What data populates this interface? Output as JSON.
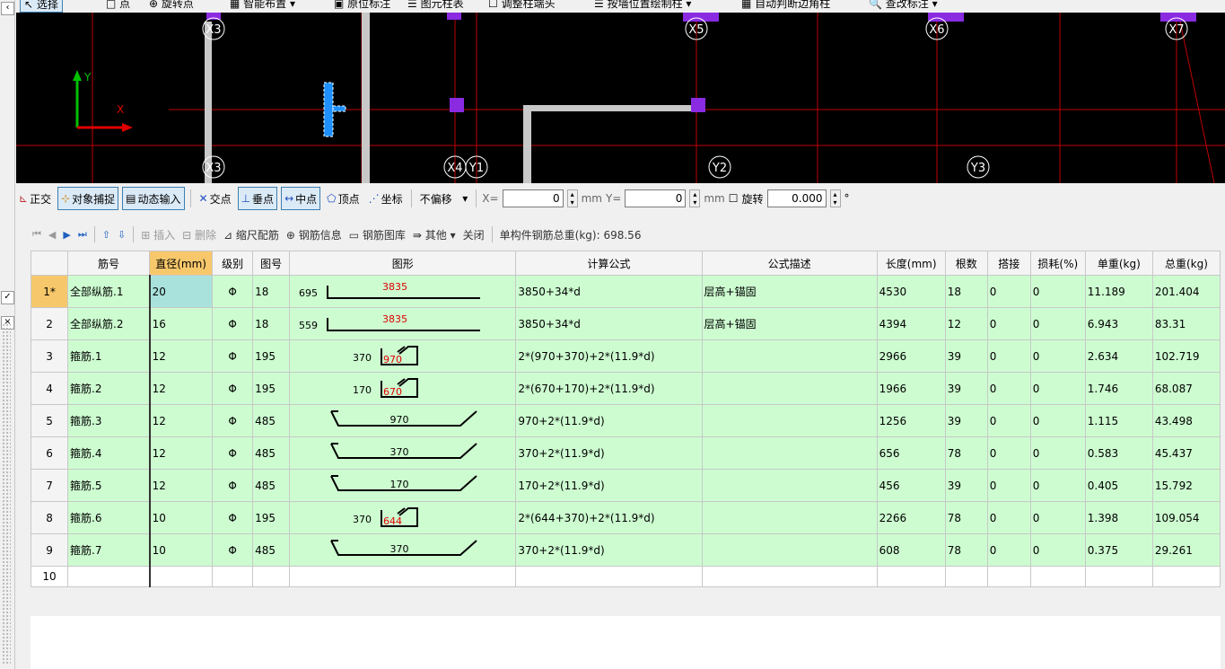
{
  "top_toolbar": {
    "select": "选择",
    "point": "点",
    "rotate_point": "旋转点",
    "smart_layout": "智能布置",
    "original_label": "原位标注",
    "graph_table": "图元柱表",
    "adjust_col_end": "调整柱端头",
    "by_wall_edit": "按墙位置绘制柱",
    "auto_judge": "自动判断边角柱",
    "query_label": "查改标注"
  },
  "canvas": {
    "axis_labels_top": [
      "X3",
      "X5",
      "X6",
      "X7"
    ],
    "axis_labels_bottom": [
      "X3",
      "X4",
      "Y1",
      "Y2",
      "Y3"
    ],
    "ucs_y": "Y",
    "ucs_x": "X",
    "colors": {
      "grid_line": "#c00000",
      "wall": "#c8c8c8",
      "column": "#8a2be2",
      "ucs_y": "#00c000",
      "ucs_x": "#e00000",
      "selected": "#1e90ff"
    }
  },
  "snapbar": {
    "ortho": "正交",
    "object_snap": "对象捕捉",
    "dynamic_input": "动态输入",
    "intersection": "交点",
    "perpendicular": "垂点",
    "midpoint": "中点",
    "vertex": "顶点",
    "coordinate": "坐标",
    "offset_mode": "不偏移",
    "x_label": "X=",
    "x_value": "0",
    "x_unit": "mm",
    "y_label": "Y=",
    "y_value": "0",
    "y_unit": "mm",
    "rotate": "旋转",
    "rotate_value": "0.000",
    "degree": "°"
  },
  "gridbar": {
    "insert": "插入",
    "delete": "删除",
    "scale_rebar": "缩尺配筋",
    "rebar_info": "钢筋信息",
    "rebar_library": "钢筋图库",
    "other": "其他",
    "close": "关闭",
    "total_weight_label": "单构件钢筋总重(kg): 698.56"
  },
  "table": {
    "headers": [
      "筋号",
      "直径(mm)",
      "级别",
      "图号",
      "图形",
      "计算公式",
      "公式描述",
      "长度(mm)",
      "根数",
      "搭接",
      "损耗(%)",
      "单重(kg)",
      "总重(kg)"
    ],
    "rows": [
      {
        "rn": "1*",
        "name": "全部纵筋.1",
        "dia": "20",
        "grade": "Φ",
        "fig": "18",
        "shape": {
          "kind": "L",
          "left": "695",
          "mid": "3835"
        },
        "formula": "3850+34*d",
        "desc": "层高+锚固",
        "len": "4530",
        "count": "18",
        "lap": "0",
        "loss": "0",
        "unit": "11.189",
        "total": "201.404"
      },
      {
        "rn": "2",
        "name": "全部纵筋.2",
        "dia": "16",
        "grade": "Φ",
        "fig": "18",
        "shape": {
          "kind": "L",
          "left": "559",
          "mid": "3835"
        },
        "formula": "3850+34*d",
        "desc": "层高+锚固",
        "len": "4394",
        "count": "12",
        "lap": "0",
        "loss": "0",
        "unit": "6.943",
        "total": "83.31"
      },
      {
        "rn": "3",
        "name": "箍筋.1",
        "dia": "12",
        "grade": "Φ",
        "fig": "195",
        "shape": {
          "kind": "stirrup",
          "left": "370",
          "mid": "970"
        },
        "formula": "2*(970+370)+2*(11.9*d)",
        "desc": "",
        "len": "2966",
        "count": "39",
        "lap": "0",
        "loss": "0",
        "unit": "2.634",
        "total": "102.719"
      },
      {
        "rn": "4",
        "name": "箍筋.2",
        "dia": "12",
        "grade": "Φ",
        "fig": "195",
        "shape": {
          "kind": "stirrup",
          "left": "170",
          "mid": "670"
        },
        "formula": "2*(670+170)+2*(11.9*d)",
        "desc": "",
        "len": "1966",
        "count": "39",
        "lap": "0",
        "loss": "0",
        "unit": "1.746",
        "total": "68.087"
      },
      {
        "rn": "5",
        "name": "箍筋.3",
        "dia": "12",
        "grade": "Φ",
        "fig": "485",
        "shape": {
          "kind": "tie",
          "mid": "970"
        },
        "formula": "970+2*(11.9*d)",
        "desc": "",
        "len": "1256",
        "count": "39",
        "lap": "0",
        "loss": "0",
        "unit": "1.115",
        "total": "43.498"
      },
      {
        "rn": "6",
        "name": "箍筋.4",
        "dia": "12",
        "grade": "Φ",
        "fig": "485",
        "shape": {
          "kind": "tie",
          "mid": "370"
        },
        "formula": "370+2*(11.9*d)",
        "desc": "",
        "len": "656",
        "count": "78",
        "lap": "0",
        "loss": "0",
        "unit": "0.583",
        "total": "45.437"
      },
      {
        "rn": "7",
        "name": "箍筋.5",
        "dia": "12",
        "grade": "Φ",
        "fig": "485",
        "shape": {
          "kind": "tie",
          "mid": "170"
        },
        "formula": "170+2*(11.9*d)",
        "desc": "",
        "len": "456",
        "count": "39",
        "lap": "0",
        "loss": "0",
        "unit": "0.405",
        "total": "15.792"
      },
      {
        "rn": "8",
        "name": "箍筋.6",
        "dia": "10",
        "grade": "Φ",
        "fig": "195",
        "shape": {
          "kind": "stirrup",
          "left": "370",
          "mid": "644"
        },
        "formula": "2*(644+370)+2*(11.9*d)",
        "desc": "",
        "len": "2266",
        "count": "78",
        "lap": "0",
        "loss": "0",
        "unit": "1.398",
        "total": "109.054"
      },
      {
        "rn": "9",
        "name": "箍筋.7",
        "dia": "10",
        "grade": "Φ",
        "fig": "485",
        "shape": {
          "kind": "tie",
          "mid": "370"
        },
        "formula": "370+2*(11.9*d)",
        "desc": "",
        "len": "608",
        "count": "78",
        "lap": "0",
        "loss": "0",
        "unit": "0.375",
        "total": "29.261"
      }
    ],
    "empty_row_number": "10"
  }
}
